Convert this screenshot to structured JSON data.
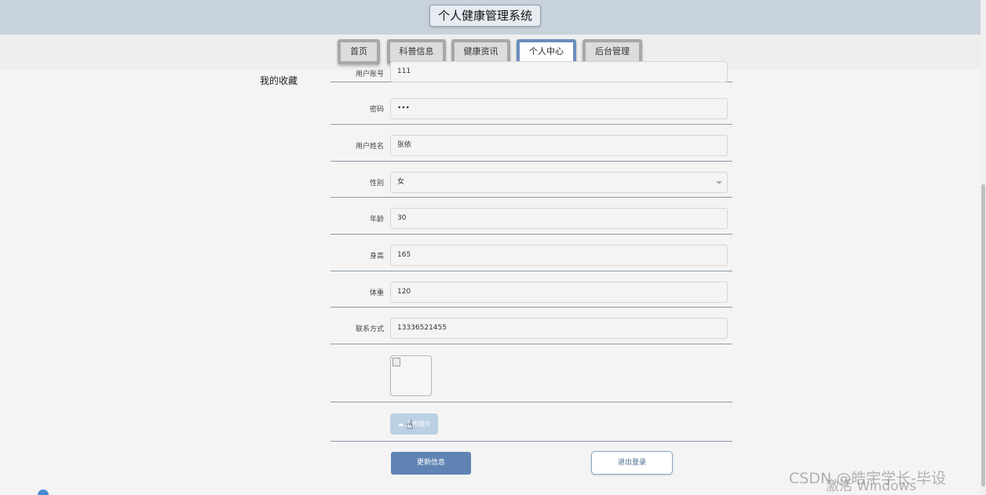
{
  "header": {
    "title": "个人健康管理系统"
  },
  "nav": {
    "tabs": [
      {
        "label": "首页"
      },
      {
        "label": "科普信息"
      },
      {
        "label": "健康资讯"
      },
      {
        "label": "个人中心"
      },
      {
        "label": "后台管理"
      }
    ],
    "active": "个人中心"
  },
  "sidebar": {
    "favorites_label": "我的收藏"
  },
  "form": {
    "rows": [
      {
        "label": "用户账号",
        "value": "111"
      },
      {
        "label": "密码",
        "value": "•••"
      },
      {
        "label": "用户姓名",
        "value": "张依"
      },
      {
        "label": "性别",
        "value": "女"
      },
      {
        "label": "年龄",
        "value": "30"
      },
      {
        "label": "身高",
        "value": "165"
      },
      {
        "label": "体重",
        "value": "120"
      },
      {
        "label": "联系方式",
        "value": "13336521455"
      }
    ],
    "upload_label": "上传图片",
    "update_label": "更新信息",
    "logout_label": "退出登录"
  },
  "overlay": {
    "watermark": "CSDN @皓宇学长-毕设",
    "activate_windows": "激活 Windows"
  },
  "colors": {
    "accent": "#5f84b3",
    "header_bg": "#c8d2dc"
  },
  "icons": {
    "cursor": "hand-cursor-icon",
    "upload": "cloud-upload-icon",
    "select": "chevron-down-icon"
  }
}
